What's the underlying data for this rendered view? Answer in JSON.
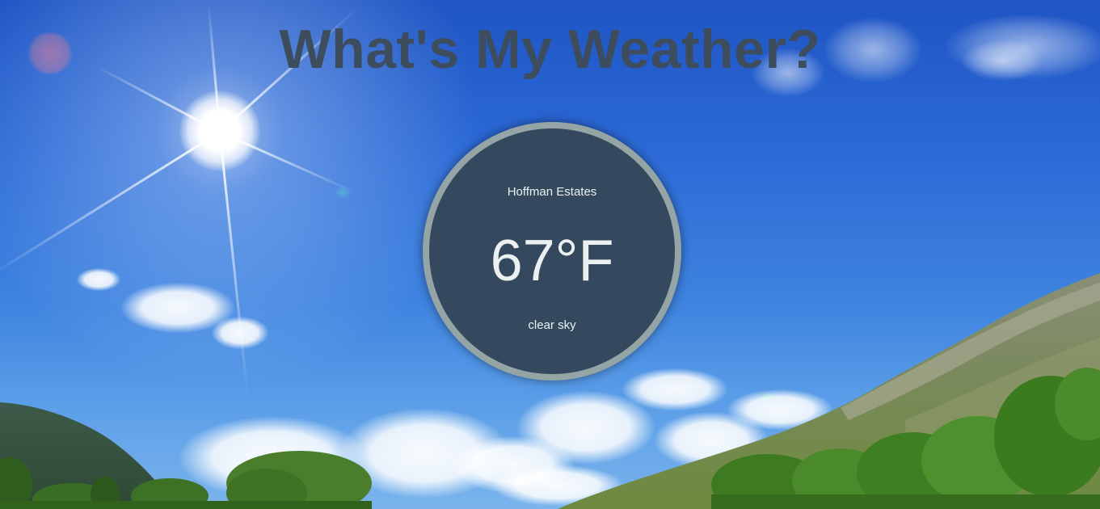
{
  "page": {
    "title": "What's My Weather?"
  },
  "weather": {
    "city": "Hoffman Estates",
    "temperature": "67°F",
    "description": "clear sky"
  },
  "colors": {
    "title": "#3d4d5e",
    "circle_fill": "#34495e",
    "circle_border": "#95a5a6",
    "circle_text": "#ecf0f1"
  },
  "background": {
    "scene": "sunny-sky-with-mountains-and-trees"
  }
}
